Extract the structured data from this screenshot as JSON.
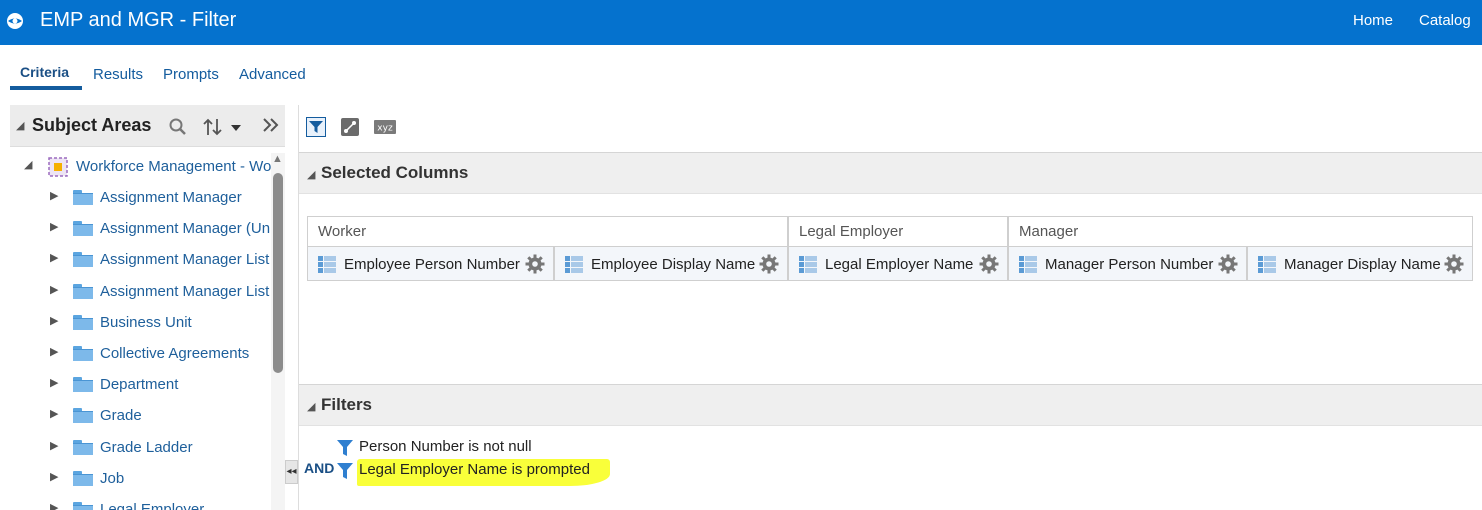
{
  "header": {
    "title": "EMP and MGR - Filter",
    "nav": [
      "Home",
      "Catalog"
    ],
    "logo_icon": "globe-icon"
  },
  "tabs": [
    "Criteria",
    "Results",
    "Prompts",
    "Advanced"
  ],
  "active_tab": "Criteria",
  "subject_areas": {
    "label": "Subject Areas",
    "root": "Workforce Management - Wo",
    "items": [
      "Assignment Manager",
      "Assignment Manager (Un",
      "Assignment Manager List",
      "Assignment Manager List",
      "Business Unit",
      "Collective Agreements",
      "Department",
      "Grade",
      "Grade Ladder",
      "Job",
      "Legal Employer"
    ]
  },
  "selected_columns": {
    "label": "Selected Columns",
    "groups": [
      {
        "name": "Worker",
        "columns": [
          "Employee Person Number",
          "Employee Display Name"
        ]
      },
      {
        "name": "Legal Employer",
        "columns": [
          "Legal Employer Name"
        ]
      },
      {
        "name": "Manager",
        "columns": [
          "Manager Person Number",
          "Manager Display Name"
        ]
      }
    ]
  },
  "filters": {
    "label": "Filters",
    "operator": "AND",
    "items": [
      "Person Number is not null",
      "Legal Employer Name is prompted"
    ]
  },
  "colors": {
    "header_bg": "#0572ce",
    "link": "#1e5f9b",
    "highlight": "#f9ff3a"
  }
}
